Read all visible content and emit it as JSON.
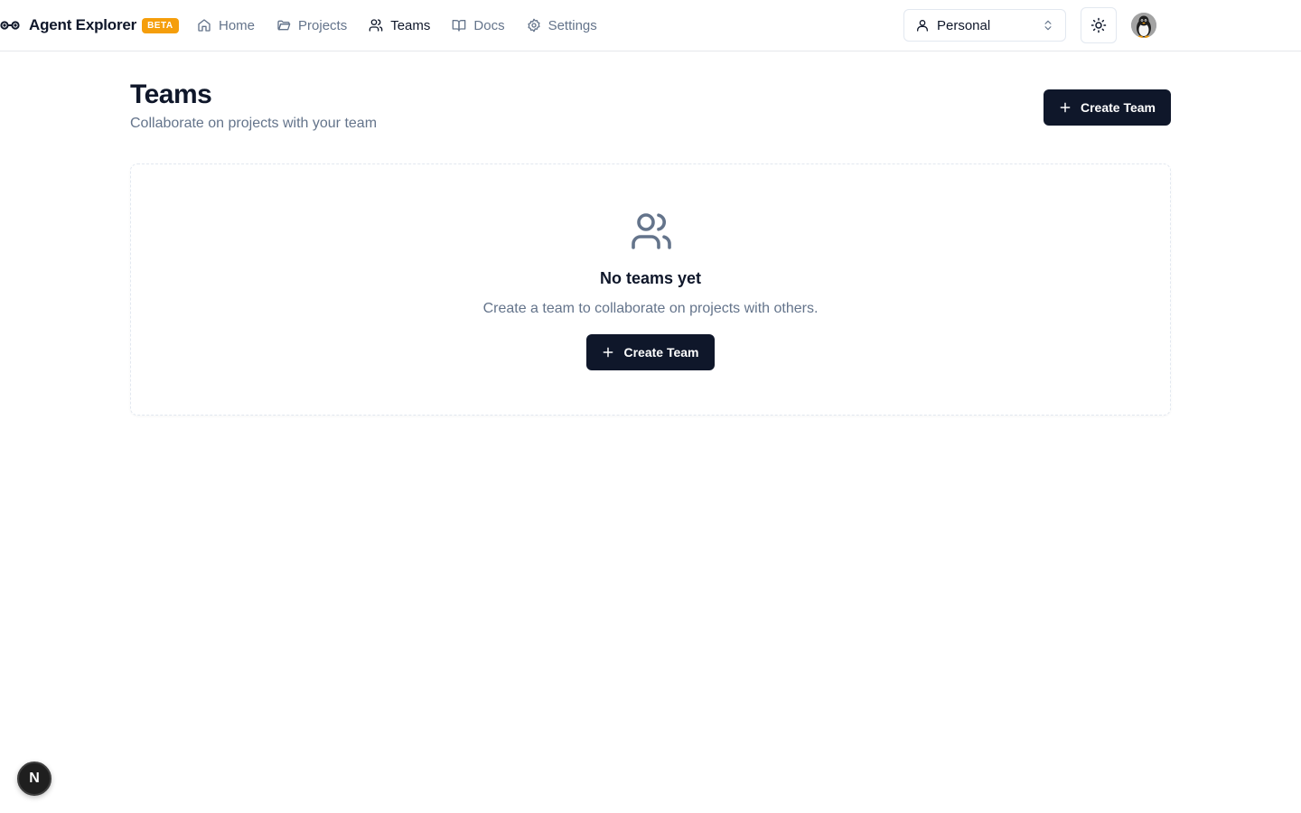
{
  "app": {
    "name": "Agent Explorer",
    "badge": "BETA"
  },
  "nav": {
    "items": [
      {
        "label": "Home",
        "icon": "home-icon",
        "active": false
      },
      {
        "label": "Projects",
        "icon": "folder-icon",
        "active": false
      },
      {
        "label": "Teams",
        "icon": "users-icon",
        "active": true
      },
      {
        "label": "Docs",
        "icon": "book-icon",
        "active": false
      },
      {
        "label": "Settings",
        "icon": "gear-icon",
        "active": false
      }
    ]
  },
  "workspace": {
    "selected": "Personal"
  },
  "page": {
    "title": "Teams",
    "subtitle": "Collaborate on projects with your team",
    "create_button": "Create Team"
  },
  "empty_state": {
    "title": "No teams yet",
    "description": "Create a team to collaborate on projects with others.",
    "button": "Create Team"
  },
  "dev_badge": {
    "label": "N"
  },
  "colors": {
    "primary": "#0f172a",
    "muted": "#64748b",
    "beta": "#f59e0b",
    "border": "#e2e8f0"
  }
}
